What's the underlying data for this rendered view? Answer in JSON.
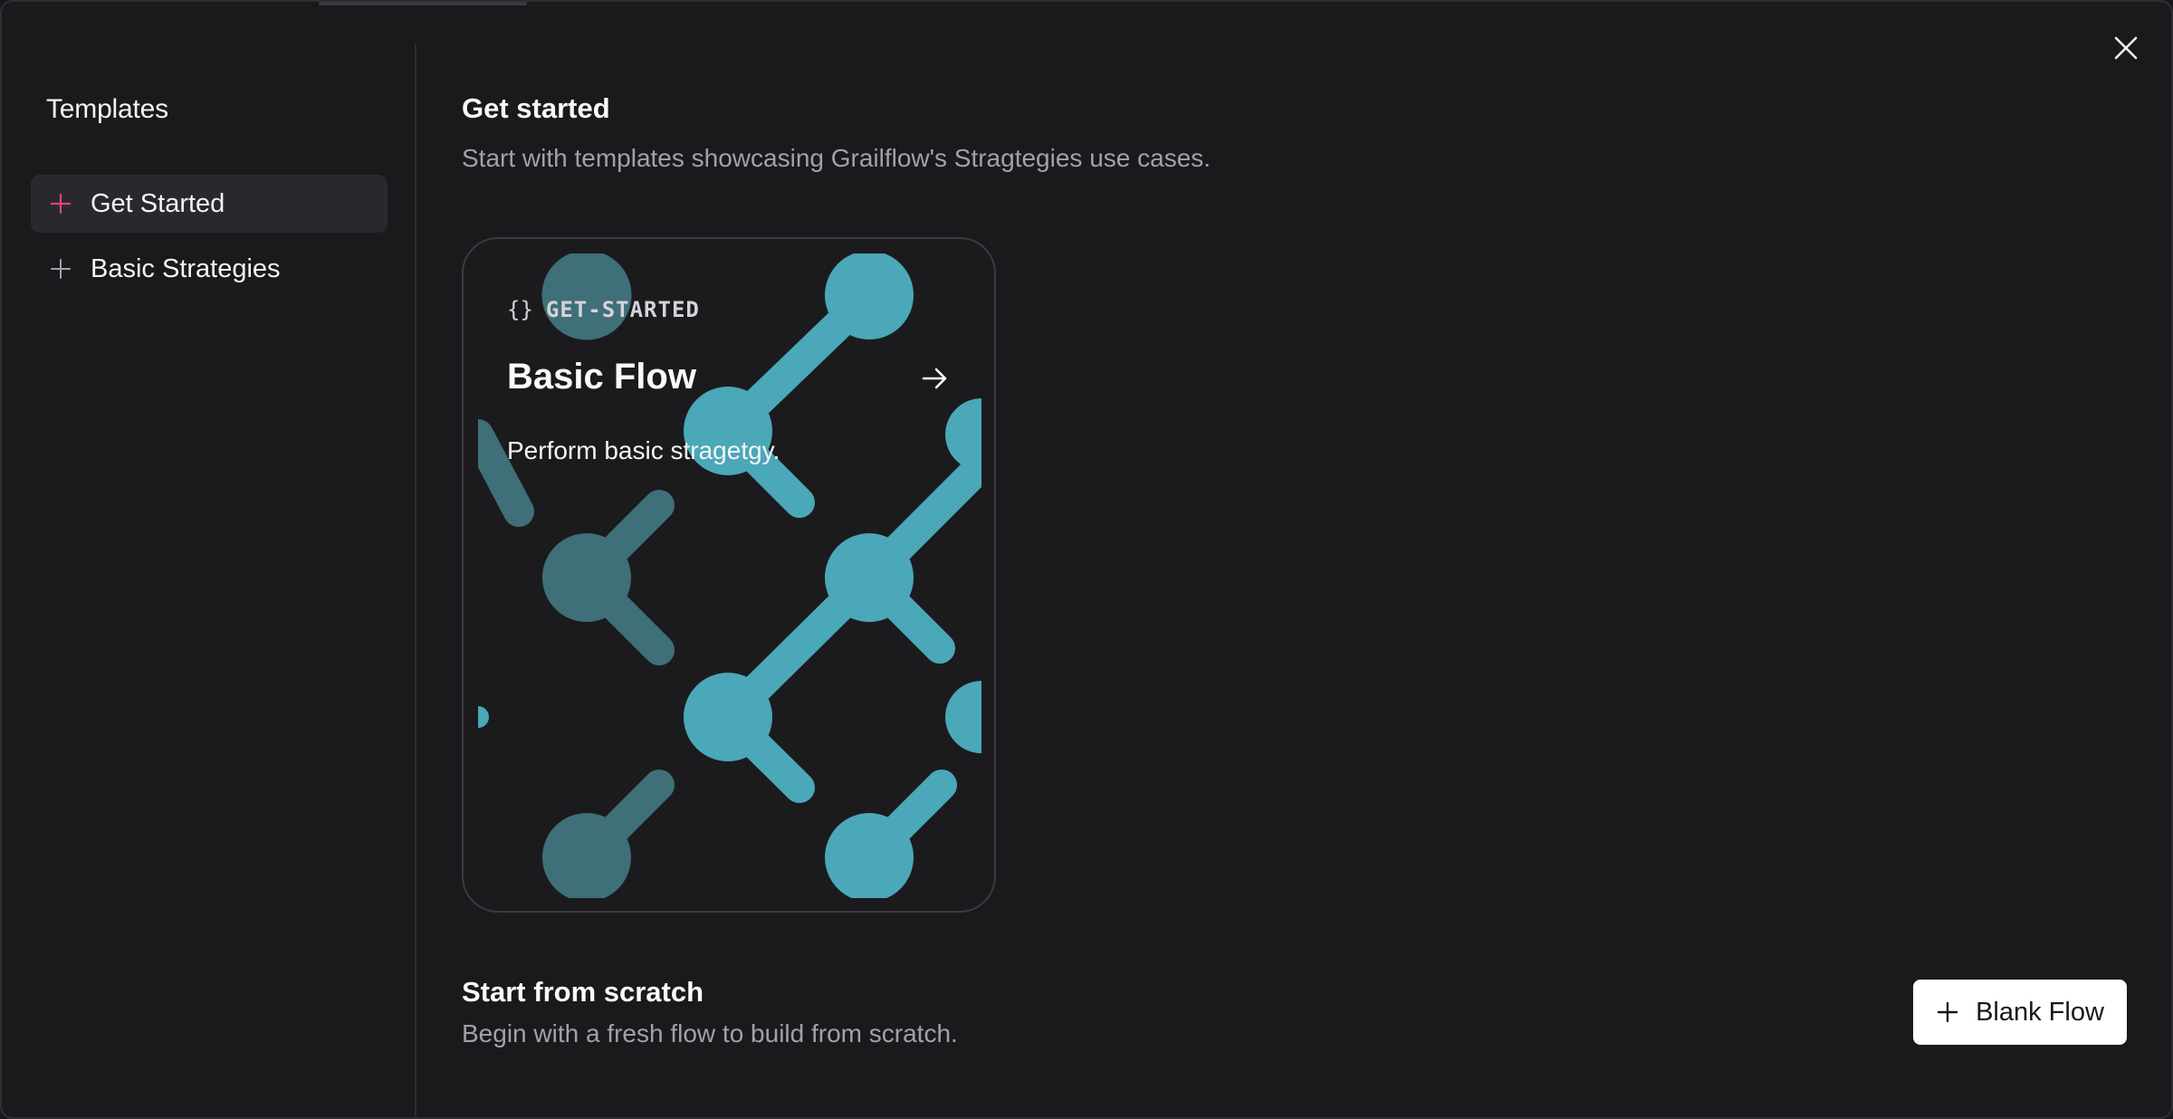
{
  "sidebar": {
    "title": "Templates",
    "items": [
      {
        "label": "Get Started",
        "active": true,
        "icon": "plus-icon",
        "icon_color": "#e0437a"
      },
      {
        "label": "Basic Strategies",
        "active": false,
        "icon": "plus-icon",
        "icon_color": "#a1a1aa"
      }
    ]
  },
  "main": {
    "section_title": "Get started",
    "section_subtitle": "Start with templates showcasing Grailflow's Stragtegies use cases.",
    "card": {
      "tag_icon": "{}",
      "tag": "GET-STARTED",
      "title": "Basic Flow",
      "description": "Perform basic stragetgy.",
      "arrow_icon": "arrow-right-icon",
      "art_color": "#4aa8b8"
    },
    "scratch_title": "Start from scratch",
    "scratch_subtitle": "Begin with a fresh flow to build from scratch.",
    "blank_button_label": "Blank Flow"
  },
  "close_icon": "close-icon"
}
